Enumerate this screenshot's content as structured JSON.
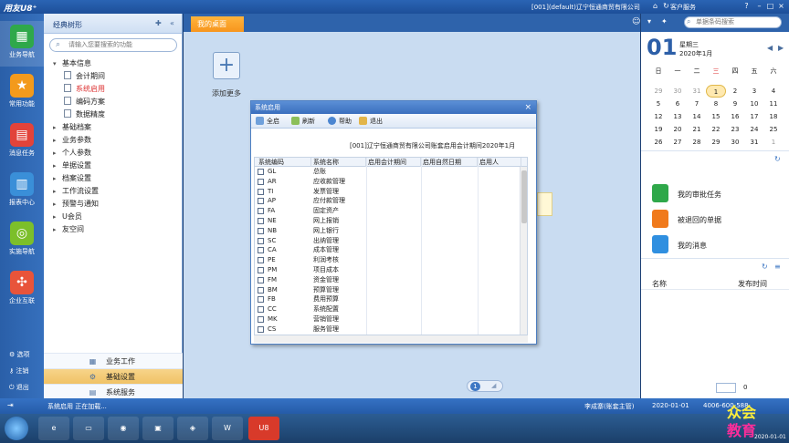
{
  "titlebar": {
    "logo": "用友U8⁺",
    "title": "[001](default)辽宁恒通商贸有限公司",
    "customer_service": "客户服务",
    "search_placeholder": "单据条码搜索"
  },
  "rail": {
    "items": [
      {
        "label": "业务导航",
        "icon": "grid-icon",
        "color": "#2fa84a"
      },
      {
        "label": "常用功能",
        "icon": "star-icon",
        "color": "#f39a1c"
      },
      {
        "label": "消息任务",
        "icon": "calendar-icon",
        "color": "#e2433a"
      },
      {
        "label": "报表中心",
        "icon": "report-icon",
        "color": "#3a8fd8"
      },
      {
        "label": "实施导航",
        "icon": "compass-icon",
        "color": "#7cbf2a"
      },
      {
        "label": "企业互联",
        "icon": "connect-icon",
        "color": "#e8543a"
      }
    ],
    "options": "选项",
    "logout": "注销",
    "exit": "退出"
  },
  "nav": {
    "title": "经典树形",
    "search_placeholder": "请输入您要搜索的功能",
    "tree": [
      {
        "label": "基本信息",
        "type": "open"
      },
      {
        "label": "会计期间",
        "type": "leaf"
      },
      {
        "label": "系统启用",
        "type": "leaf",
        "selected": true
      },
      {
        "label": "编码方案",
        "type": "leaf"
      },
      {
        "label": "数据精度",
        "type": "leaf"
      },
      {
        "label": "基础档案",
        "type": "closed"
      },
      {
        "label": "业务参数",
        "type": "closed"
      },
      {
        "label": "个人参数",
        "type": "closed"
      },
      {
        "label": "单据设置",
        "type": "closed"
      },
      {
        "label": "档案设置",
        "type": "closed"
      },
      {
        "label": "工作流设置",
        "type": "closed"
      },
      {
        "label": "预警与通知",
        "type": "closed"
      },
      {
        "label": "U会员",
        "type": "closed"
      },
      {
        "label": "友空间",
        "type": "closed"
      }
    ],
    "groups": [
      {
        "label": "业务工作",
        "active": false
      },
      {
        "label": "基础设置",
        "active": true
      },
      {
        "label": "系统服务",
        "active": false
      }
    ]
  },
  "main": {
    "tab": "我的桌面",
    "add_more": "添加更多",
    "page": "1"
  },
  "dialog": {
    "title": "系统启用",
    "toolbar": [
      "全启",
      "刷新",
      "帮助",
      "退出"
    ],
    "heading": "[001]辽宁恒通商贸有限公司账套启用会计期间2020年1月",
    "columns": [
      "系统编码",
      "系统名称",
      "启用会计期间",
      "启用自然日期",
      "启用人"
    ],
    "rows": [
      {
        "code": "GL",
        "name": "总账"
      },
      {
        "code": "AR",
        "name": "应收款管理"
      },
      {
        "code": "TI",
        "name": "发票管理"
      },
      {
        "code": "AP",
        "name": "应付款管理"
      },
      {
        "code": "FA",
        "name": "固定资产"
      },
      {
        "code": "NE",
        "name": "网上报销"
      },
      {
        "code": "NB",
        "name": "网上银行"
      },
      {
        "code": "SC",
        "name": "出纳管理"
      },
      {
        "code": "CA",
        "name": "成本管理"
      },
      {
        "code": "PE",
        "name": "利润考核"
      },
      {
        "code": "PM",
        "name": "项目成本"
      },
      {
        "code": "FM",
        "name": "资金管理"
      },
      {
        "code": "BM",
        "name": "预算管理"
      },
      {
        "code": "FB",
        "name": "费用预算"
      },
      {
        "code": "CC",
        "name": "系统配置"
      },
      {
        "code": "MK",
        "name": "营销管理"
      },
      {
        "code": "CS",
        "name": "服务管理"
      }
    ]
  },
  "calendar": {
    "day": "01",
    "weekday": "星期三",
    "month": "2020年1月",
    "headers": [
      "日",
      "一",
      "二",
      "三",
      "四",
      "五",
      "六"
    ],
    "weeks": [
      [
        "29",
        "30",
        "31",
        "1",
        "2",
        "3",
        "4"
      ],
      [
        "5",
        "6",
        "7",
        "8",
        "9",
        "10",
        "11"
      ],
      [
        "12",
        "13",
        "14",
        "15",
        "16",
        "17",
        "18"
      ],
      [
        "19",
        "20",
        "21",
        "22",
        "23",
        "24",
        "25"
      ],
      [
        "26",
        "27",
        "28",
        "29",
        "30",
        "31",
        "1"
      ]
    ]
  },
  "tasks": [
    {
      "label": "我的审批任务",
      "color": "#2fa84a"
    },
    {
      "label": "被退回的单据",
      "color": "#f07a1c"
    },
    {
      "label": "我的消息",
      "color": "#2f8fe0"
    }
  ],
  "messages": {
    "col_name": "名称",
    "col_time": "发布时间",
    "page": "0"
  },
  "status": {
    "text": "系统启用 正在加载...",
    "user": "李成寨(账套主管)",
    "date": "2020-01-01",
    "phone": "4006-600-588"
  },
  "watermark": {
    "line1": "众会",
    "line2": "教育",
    "tray_date": "2020-01-01"
  }
}
